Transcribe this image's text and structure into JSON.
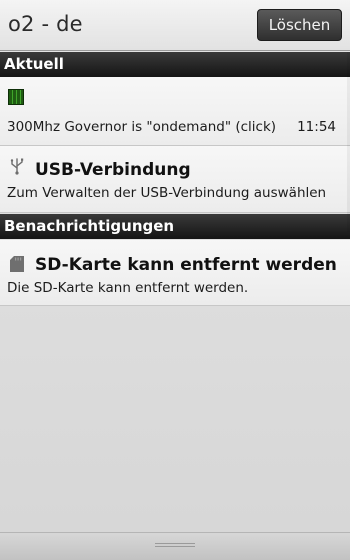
{
  "header": {
    "operator": "o2 - de",
    "clear_label": "Löschen"
  },
  "sections": {
    "current": "Aktuell",
    "notifications": "Benachrichtigungen"
  },
  "current_items": [
    {
      "icon": "cpu-chip-icon",
      "text": "300Mhz Governor is \"ondemand\" (click)",
      "time": "11:54"
    },
    {
      "icon": "usb-icon",
      "title": "USB-Verbindung",
      "text": "Zum Verwalten der USB-Verbindung auswählen"
    }
  ],
  "notification_items": [
    {
      "icon": "sd-card-icon",
      "title": "SD-Karte kann entfernt werden",
      "text": "Die SD-Karte kann entfernt werden."
    }
  ]
}
